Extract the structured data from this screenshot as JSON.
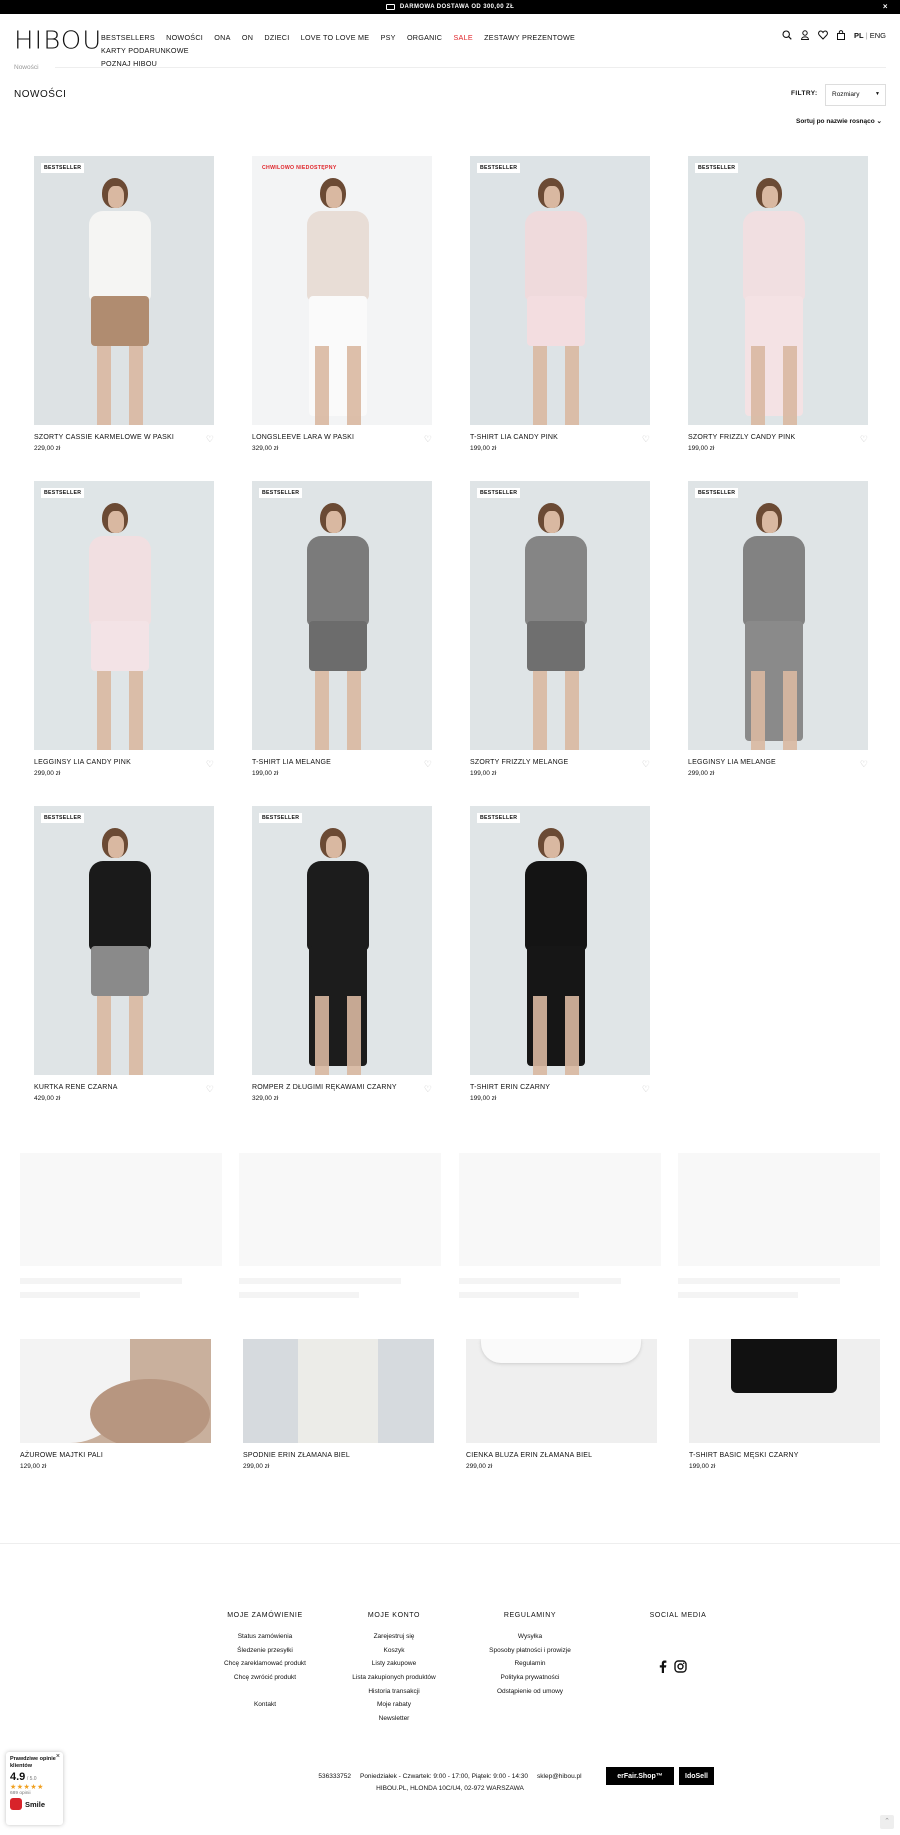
{
  "topbar": {
    "text": "DARMOWA DOSTAWA OD 300,00 ZŁ",
    "close": "×"
  },
  "header": {
    "logo": "HIBOU",
    "nav": [
      "BESTSELLERS",
      "NOWOŚCI",
      "ONA",
      "ON",
      "DZIECI",
      "LOVE TO LOVE ME",
      "PSY",
      "ORGANIC",
      "SALE",
      "ZESTAWY PREZENTOWE",
      "KARTY PODARUNKOWE",
      "POZNAJ HIBOU"
    ],
    "lang_pl": "PL",
    "lang_sep": "|",
    "lang_eng": "ENG"
  },
  "breadcrumb": "Nowości",
  "page_title": "NOWOŚCI",
  "filters": {
    "label": "FILTRY:",
    "sizes": "Rozmiary"
  },
  "sort": "Sortuj po nazwie rosnąco",
  "products": [
    {
      "name": "SZORTY CASSIE KARMELOWE W PASKI",
      "price": "229,00 zł",
      "badge": "BESTSELLER",
      "top": "#f5f5f3",
      "bottom": "#b08c70",
      "bg": "#dde2e4"
    },
    {
      "name": "LONGSLEEVE LARA W PASKI",
      "price": "329,00 zł",
      "badge": "CHWILOWO NIEDOSTĘPNY",
      "top": "#e8ddd6",
      "bottom": "#fafafa",
      "bg": "#f3f4f5"
    },
    {
      "name": "T-SHIRT LIA CANDY PINK",
      "price": "199,00 zł",
      "badge": "BESTSELLER",
      "top": "#efdadc",
      "bottom": "#f3dde0",
      "bg": "#dde3e6"
    },
    {
      "name": "SZORTY FRIZZLY CANDY PINK",
      "price": "199,00 zł",
      "badge": "BESTSELLER",
      "top": "#f1dfe1",
      "bottom": "#f4e2e4",
      "bg": "#dee4e6"
    },
    {
      "name": "LEGGINSY LIA CANDY PINK",
      "price": "299,00 zł",
      "badge": "BESTSELLER",
      "top": "#f1dfe1",
      "bottom": "#f3e3e6",
      "bg": "#dfe5e7"
    },
    {
      "name": "T-SHIRT LIA MELANGE",
      "price": "199,00 zł",
      "badge": "BESTSELLER",
      "top": "#7b7b7b",
      "bottom": "#6c6c6c",
      "bg": "#dfe4e6"
    },
    {
      "name": "SZORTY FRIZZLY MELANGE",
      "price": "199,00 zł",
      "badge": "BESTSELLER",
      "top": "#858585",
      "bottom": "#6f6f6f",
      "bg": "#dfe4e6"
    },
    {
      "name": "LEGGINSY LIA MELANGE",
      "price": "299,00 zł",
      "badge": "BESTSELLER",
      "top": "#828282",
      "bottom": "#8a8a8a",
      "bg": "#dfe4e6"
    },
    {
      "name": "KURTKA RENE CZARNA",
      "price": "429,00 zł",
      "badge": "BESTSELLER",
      "top": "#1a1a1a",
      "bottom": "#8a8a8a",
      "bg": "#dfe4e6"
    },
    {
      "name": "ROMPER Z DŁUGIMI RĘKAWAMI CZARNY",
      "price": "329,00 zł",
      "badge": "BESTSELLER",
      "top": "#1c1c1c",
      "bottom": "#1c1c1c",
      "bg": "#e0e5e7"
    },
    {
      "name": "T-SHIRT ERIN CZARNY",
      "price": "199,00 zł",
      "badge": "BESTSELLER",
      "top": "#141414",
      "bottom": "#161616",
      "bg": "#e0e5e7"
    }
  ],
  "recommended": [
    {
      "name": "AŻUROWE MAJTKI PALI",
      "price": "129,00 zł"
    },
    {
      "name": "SPODNIE ERIN ZŁAMANA BIEL",
      "price": "299,00 zł"
    },
    {
      "name": "CIENKA BLUZA ERIN ZŁAMANA BIEL",
      "price": "299,00 zł"
    },
    {
      "name": "T-SHIRT BASIC MĘSKI CZARNY",
      "price": "199,00 zł"
    }
  ],
  "footer": {
    "col1": {
      "title": "MOJE ZAMÓWIENIE",
      "items": [
        "Status zamówienia",
        "Śledzenie przesyłki",
        "Chcę zareklamować produkt",
        "Chcę zwrócić produkt"
      ],
      "extra": "Kontakt"
    },
    "col2": {
      "title": "MOJE KONTO",
      "items": [
        "Zarejestruj się",
        "Koszyk",
        "Listy zakupowe",
        "Lista zakupionych produktów",
        "Historia transakcji",
        "Moje rabaty",
        "Newsletter"
      ]
    },
    "col3": {
      "title": "REGULAMINY",
      "items": [
        "Wysyłka",
        "Sposoby płatności i prowizje",
        "Regulamin",
        "Polityka prywatności",
        "Odstąpienie od umowy"
      ]
    },
    "col4": {
      "title": "SOCIAL MEDIA"
    },
    "phone": "536333752",
    "hours": "Poniedziałek - Czwartek: 9:00 - 17:00, Piątek: 9:00 - 14:30",
    "email": "sklep@hibou.pl",
    "address": "HIBOU.PL, HLONDA 10C/U4, 02-972 WARSZAWA",
    "partner1": "erFair.Shop™",
    "partner2": "IdoSell"
  },
  "widget": {
    "title": "Prawdziwe opinie klientów",
    "score": "4.9",
    "of": "/ 5.0",
    "stars": "★★★★★",
    "count": "689 opinii",
    "brand": "Smile",
    "close": "×"
  }
}
